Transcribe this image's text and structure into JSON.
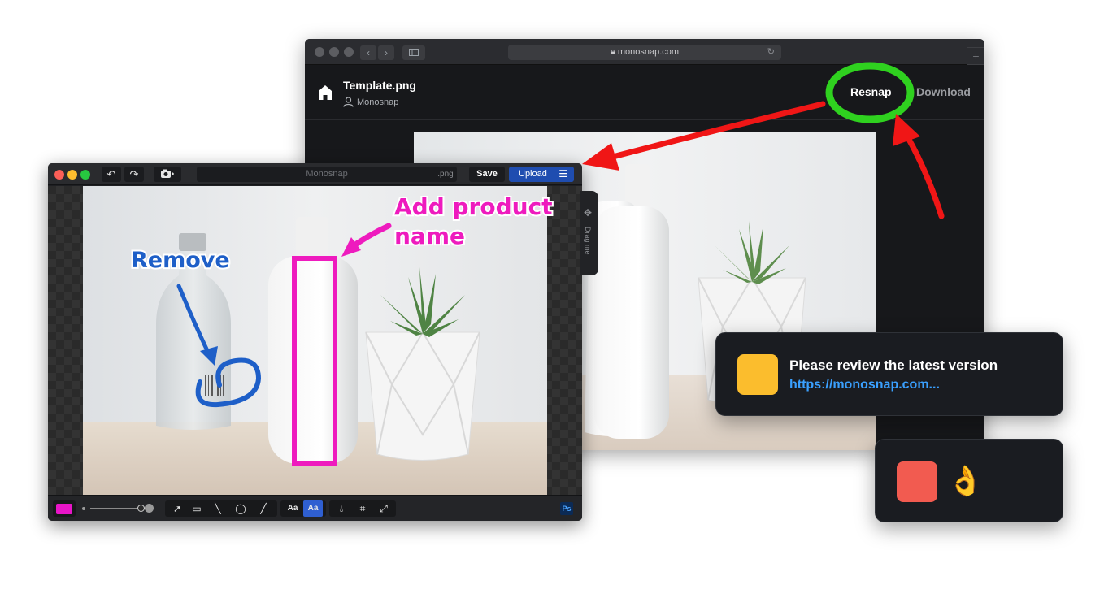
{
  "browser": {
    "url": "monosnap.com",
    "lock_icon": "lock-icon",
    "file_title": "Template.png",
    "owner": "Monosnap",
    "resnap_label": "Resnap",
    "download_label": "Download",
    "plus_label": "+"
  },
  "editor": {
    "file_name": "Monosnap",
    "extension": ".png",
    "save_label": "Save",
    "upload_label": "Upload",
    "drag_label": "Drag me",
    "text_tool_label": "Aa",
    "text_tool_active_label": "Aa",
    "ps_label": "Ps",
    "active_color": "#e815c8"
  },
  "annotations": {
    "remove_label": "Remove",
    "product_line1": "Add product",
    "product_line2": "name",
    "remove_color": "#1e5fc8",
    "product_color": "#ee1bbe",
    "highlight_color": "#2fd11f",
    "arrow_color": "#f01616"
  },
  "notifications": [
    {
      "message": "Please review the latest version",
      "link": "https://monosnap.com...",
      "color": "#fbbd2d"
    },
    {
      "emoji": "👌",
      "color": "#f25b50"
    }
  ]
}
